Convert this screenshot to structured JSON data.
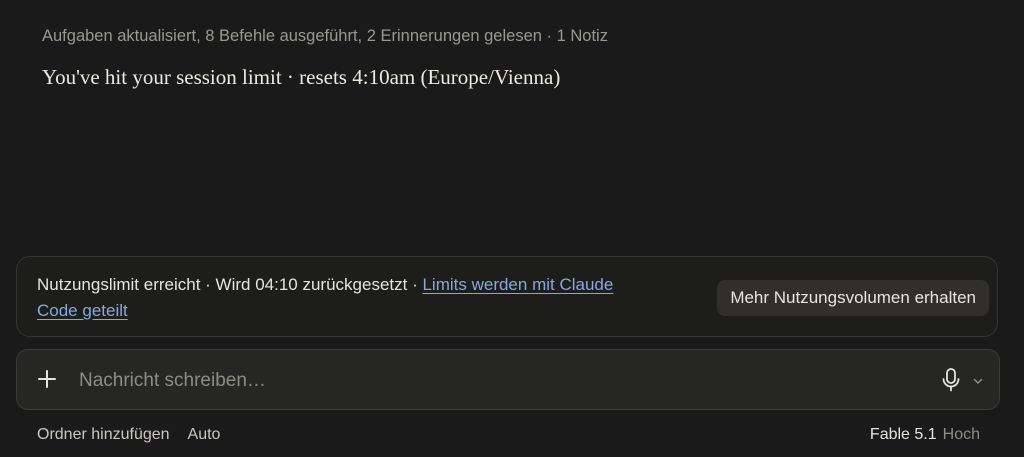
{
  "conversation": {
    "activity_summary": "Aufgaben aktualisiert, 8 Befehle ausgeführt, 2 Erinnerungen gelesen · 1 Notiz",
    "assistant_message": "You've hit your session limit · resets 4:10am (Europe/Vienna)"
  },
  "limit_banner": {
    "text": "Nutzungslimit erreicht · Wird 04:10 zurückgesetzt · ",
    "link_label": "Limits werden mit Claude Code geteilt",
    "button_label": "Mehr Nutzungsvolumen erhalten"
  },
  "composer": {
    "placeholder": "Nachricht schreiben…",
    "icons": {
      "add": "plus-icon",
      "voice": "microphone-icon",
      "voice_menu": "chevron-down-icon"
    }
  },
  "footer": {
    "add_folder_label": "Ordner hinzufügen",
    "mode_label": "Auto",
    "model_name": "Fable 5.1",
    "model_effort": "Hoch"
  },
  "colors": {
    "background": "#1a1a1a",
    "link": "#83a9e0",
    "muted_text": "#9a9892"
  }
}
